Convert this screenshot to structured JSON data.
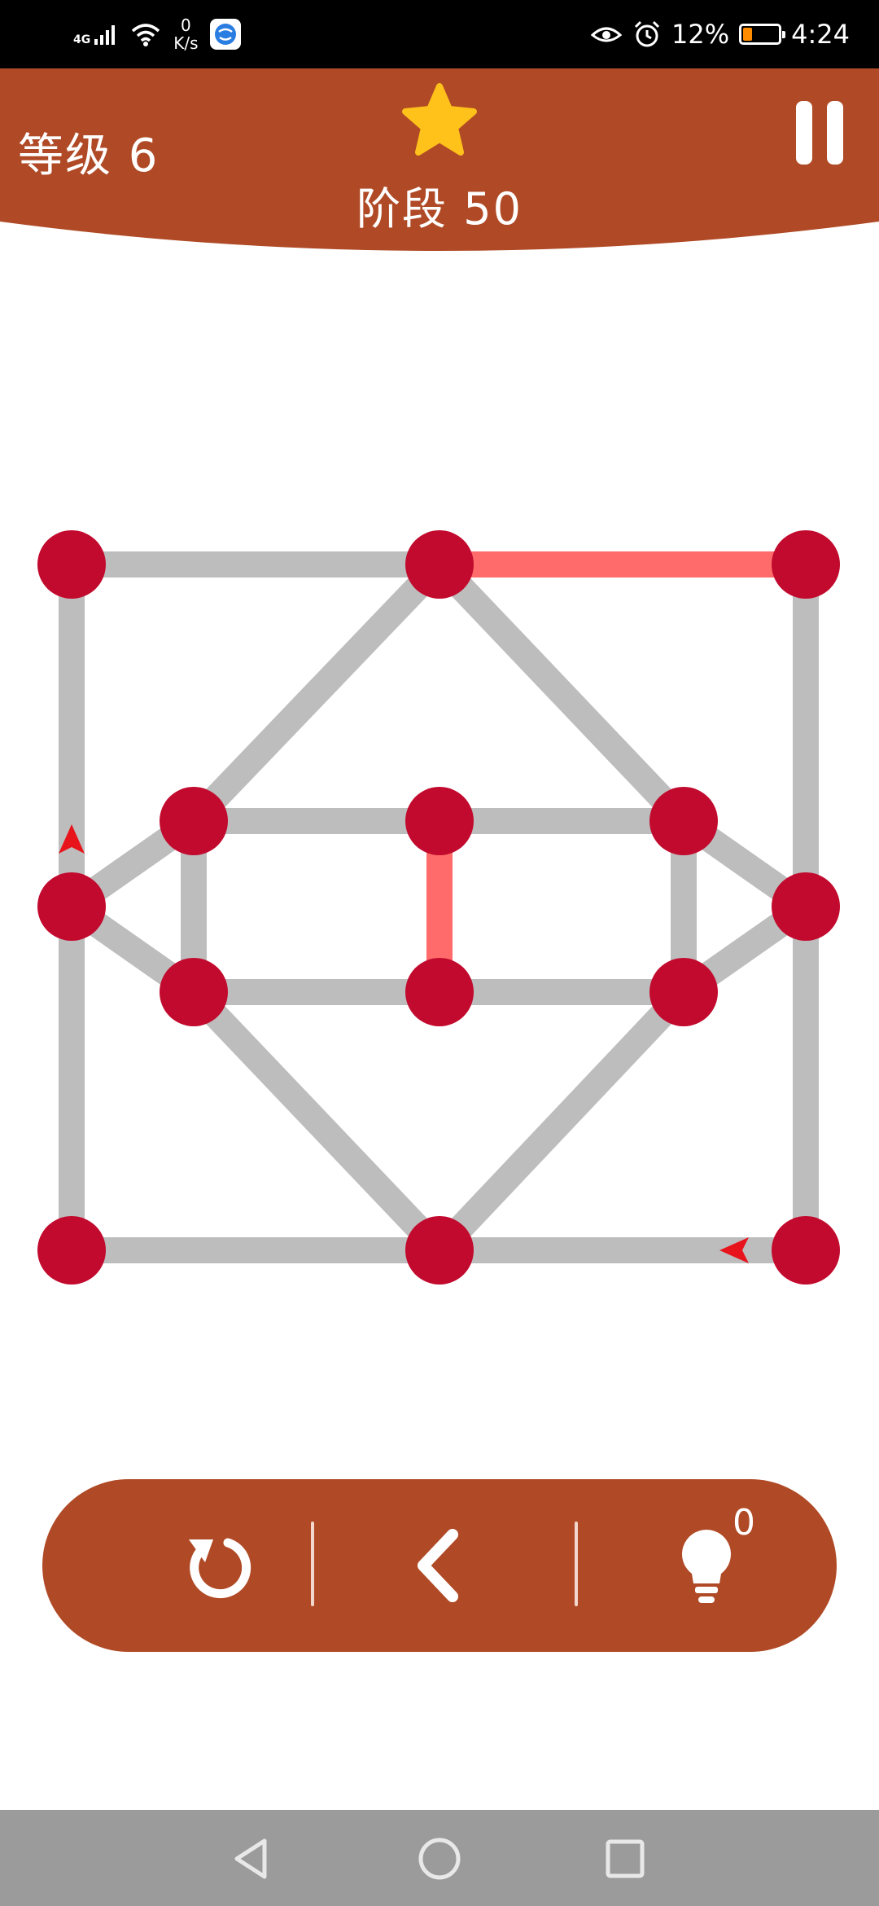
{
  "status_bar": {
    "network": "4G",
    "speed_value": "0",
    "speed_unit": "K/s",
    "battery_percent": "12%",
    "battery_level": 0.12,
    "time": "4:24"
  },
  "header": {
    "level": "等级 6",
    "stage": "阶段 50"
  },
  "hints": {
    "count": "0"
  },
  "colors": {
    "header_bg": "#b04a26",
    "node": "#c20a2e",
    "edge_idle": "#bdbdbd",
    "edge_done": "#ff6b6b",
    "arrow": "#e8141c",
    "star": "#ffc21a"
  },
  "icons": [
    "star-icon",
    "pause-icon",
    "undo-icon",
    "back-icon",
    "hint-bulb-icon",
    "nav-back-icon",
    "nav-home-icon",
    "nav-recents-icon"
  ]
}
